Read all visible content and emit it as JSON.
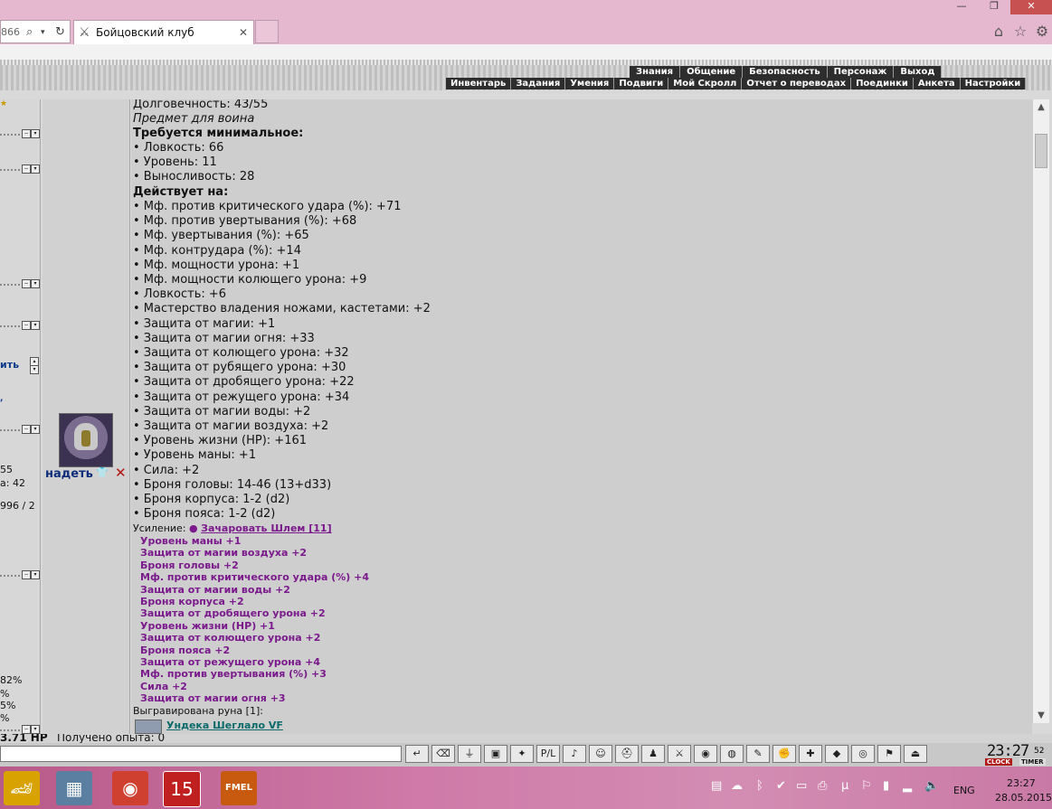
{
  "browser": {
    "address_fragment": "866",
    "tab_title": "Бойцовский клуб",
    "window_controls": [
      "minimize",
      "restore",
      "close"
    ]
  },
  "menu": {
    "main": [
      "Знания",
      "Общение",
      "Безопасность",
      "Персонаж",
      "Выход"
    ],
    "sub": [
      "Инвентарь",
      "Задания",
      "Умения",
      "Подвиги",
      "Мой Скролл",
      "Отчет о переводах",
      "Поединки",
      "Анкета",
      "Настройки"
    ]
  },
  "left_panel": {
    "fragments": [
      "ить",
      "55",
      "а: 42",
      "996 / 2",
      "82%",
      "%",
      "5%",
      "%"
    ]
  },
  "item": {
    "wear_label": "надеть",
    "durability": "Долговечность: 43/55",
    "class_note": "Предмет для воина",
    "req_header": "Требуется минимальное:",
    "requirements": [
      "• Ловкость: 66",
      "• Уровень: 11",
      "• Выносливость: 28"
    ],
    "acts_header": "Действует на:",
    "effects": [
      "• Мф. против критического удара (%): +71",
      "• Мф. против увертывания (%): +68",
      "• Мф. увертывания (%): +65",
      "• Мф. контрудара (%): +14",
      "• Мф. мощности урона: +1",
      "• Мф. мощности колющего урона: +9",
      "• Ловкость: +6",
      "• Мастерство владения ножами, кастетами: +2",
      "• Защита от магии: +1",
      "• Защита от магии огня: +33",
      "• Защита от колющего урона: +32",
      "• Защита от рубящего урона: +30",
      "• Защита от дробящего урона: +22",
      "• Защита от режущего урона: +34",
      "• Защита от магии воды: +2",
      "• Защита от магии воздуха: +2",
      "• Уровень жизни (HP): +161",
      "• Уровень маны: +1",
      "• Сила: +2",
      "• Броня головы: 14-46 (13+d33)",
      "• Броня корпуса: 1-2 (d2)",
      "• Броня пояса: 1-2 (d2)"
    ],
    "enhance_label": "Усиление:",
    "enhance_bullet": "●",
    "enhance_link": "Зачаровать Шлем [11]",
    "enchants": [
      "Уровень маны +1",
      "Защита от магии воздуха +2",
      "Броня головы +2",
      "Мф. против критического удара (%) +4",
      "Защита от магии воды +2",
      "Броня корпуса +2",
      "Защита от дробящего урона +2",
      "Уровень жизни (HP) +1",
      "Защита от колющего урона +2",
      "Броня пояса +2",
      "Защита от режущего урона +4",
      "Мф. против увертывания (%) +3",
      "Сила +2",
      "Защита от магии огня +3"
    ],
    "rune_label": "Выгравирована руна [1]:",
    "rune_name": "Ундека Шеглало VF"
  },
  "status_strip": {
    "hp_fragment": "3.71 HP",
    "exp_fragment": "Получено опыта: 0"
  },
  "clock": {
    "time": "23:27",
    "seconds": "52",
    "clock_label": "CLOCK",
    "timer_label": "TIMER"
  },
  "taskbar": {
    "apps": [
      "racing-game",
      "calculator",
      "chrome",
      "game-15",
      "fmel"
    ],
    "fmel_label": "FMEL",
    "game15_label": "15",
    "lang": "ENG",
    "time": "23:27",
    "date": "28.05.2015"
  }
}
